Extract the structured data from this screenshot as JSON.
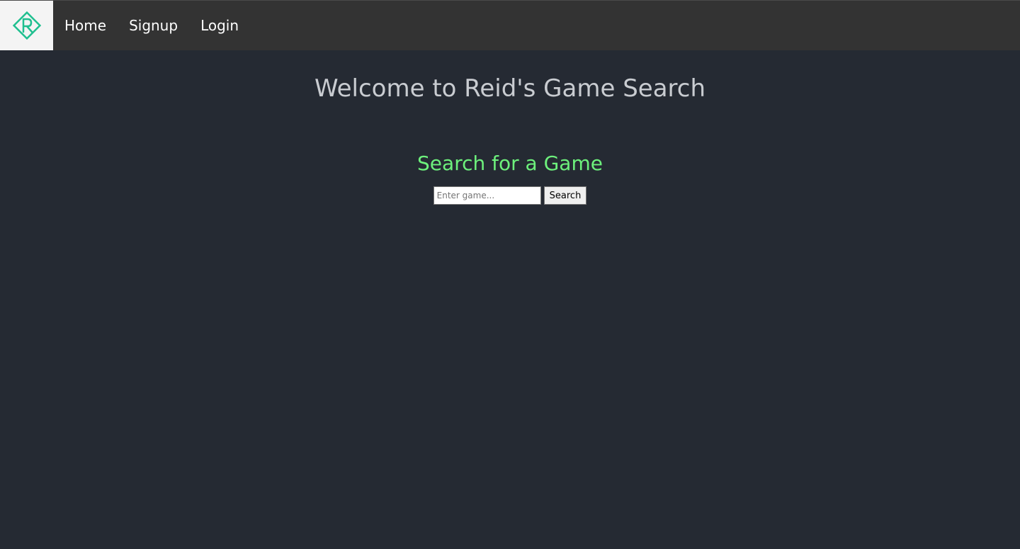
{
  "navbar": {
    "logo_icon": "diamond-r-logo-icon",
    "brand_color": "#1fbf8f",
    "links": [
      {
        "label": "Home"
      },
      {
        "label": "Signup"
      },
      {
        "label": "Login"
      }
    ]
  },
  "main": {
    "welcome_title": "Welcome to Reid's Game Search",
    "search_title": "Search for a Game",
    "search_input": {
      "placeholder": "Enter game...",
      "value": ""
    },
    "search_button_label": "Search"
  },
  "colors": {
    "background": "#252a33",
    "navbar": "#333333",
    "accent_green": "#6df07c",
    "heading_gray": "#c9ccd1"
  }
}
